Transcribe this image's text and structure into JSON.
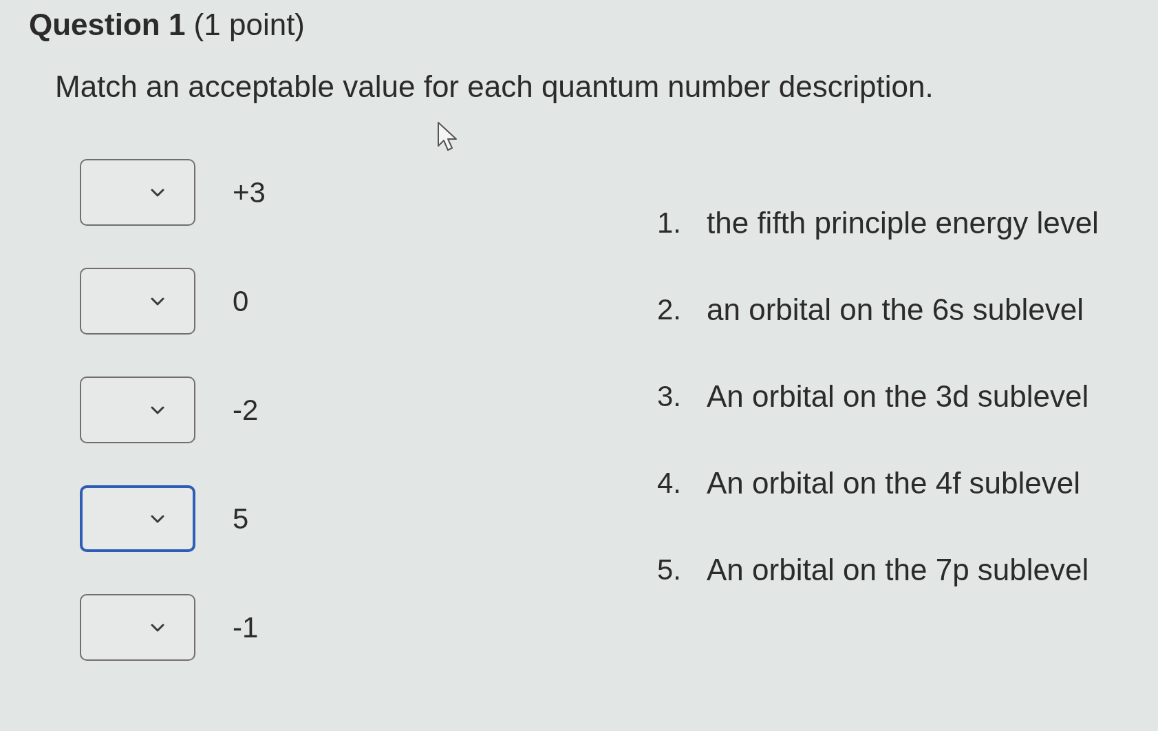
{
  "question": {
    "title": "**Question 1** (1 point)",
    "prompt": "Match an acceptable value for each quantum number description."
  },
  "matches": [
    {
      "value": "+3",
      "focused": false
    },
    {
      "value": "0",
      "focused": false
    },
    {
      "value": "-2",
      "focused": false
    },
    {
      "value": "5",
      "focused": true
    },
    {
      "value": "-1",
      "focused": false
    }
  ],
  "descriptions": [
    {
      "number": "1.",
      "text": "the fifth principle energy level"
    },
    {
      "number": "2.",
      "text": "an orbital on the 6s sublevel"
    },
    {
      "number": "3.",
      "text": "An orbital on the 3d sublevel"
    },
    {
      "number": "4.",
      "text": "An orbital on the 4f sublevel"
    },
    {
      "number": "5.",
      "text": "An orbital on the 7p sublevel"
    }
  ]
}
